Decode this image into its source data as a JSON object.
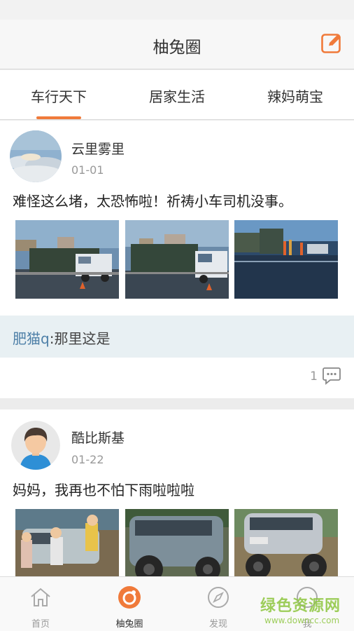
{
  "header": {
    "title": "柚兔圈"
  },
  "tabs": [
    {
      "label": "车行天下"
    },
    {
      "label": "居家生活"
    },
    {
      "label": "辣妈萌宝"
    }
  ],
  "posts": [
    {
      "user": "云里雾里",
      "date": "01-01",
      "content": "难怪这么堵，太恐怖啦！祈祷小车司机没事。",
      "comment": {
        "author": "肥猫q",
        "text": ":那里这是"
      },
      "reply_count": "1"
    },
    {
      "user": "酷比斯基",
      "date": "01-22",
      "content": "妈妈，我再也不怕下雨啦啦啦"
    }
  ],
  "bottom_nav": [
    {
      "label": "首页",
      "icon": "home-icon"
    },
    {
      "label": "柚兔圈",
      "icon": "circle-icon"
    },
    {
      "label": "发现",
      "icon": "compass-icon"
    },
    {
      "label": "我",
      "icon": "profile-icon"
    }
  ],
  "watermark": {
    "main": "绿色资源网",
    "sub": "www.downcc.com"
  },
  "colors": {
    "accent": "#f07a3a",
    "comment_author": "#4d7fa7",
    "comment_bg": "#e8f0f3"
  }
}
